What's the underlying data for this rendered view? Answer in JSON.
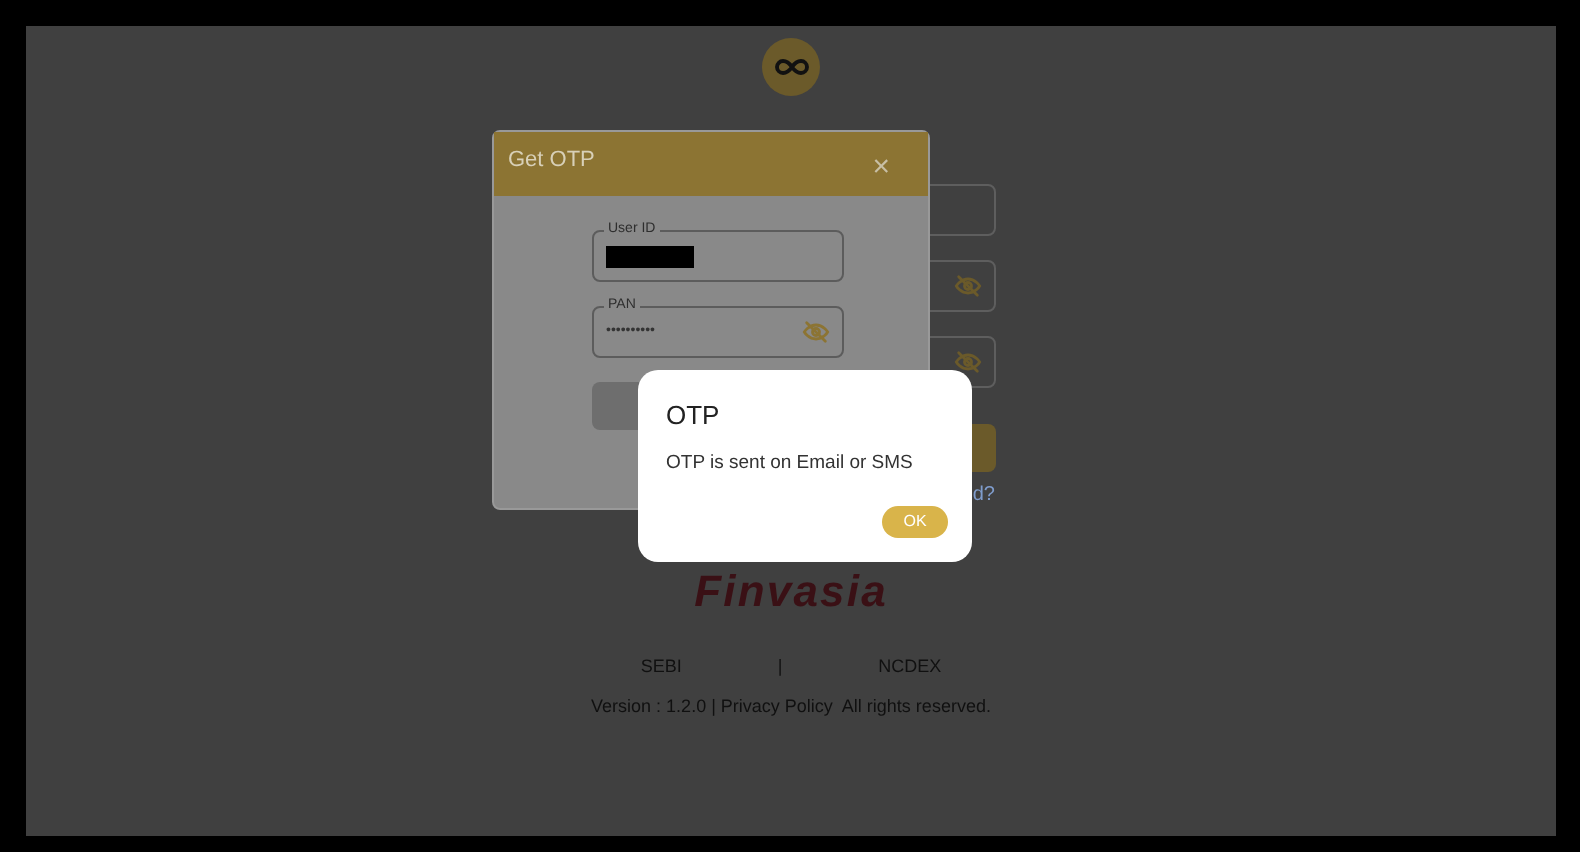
{
  "login_form": {
    "fields": [
      {
        "masked": false
      },
      {
        "masked": true
      },
      {
        "masked": true
      }
    ],
    "link": "d?"
  },
  "brand": "Finvasia",
  "footer": {
    "links": [
      "SEBI",
      "|",
      "NCDEX"
    ],
    "version_line": "Version : 1.2.0 | Privacy Policy  All rights reserved."
  },
  "get_otp_modal": {
    "title": "Get OTP",
    "close": "×",
    "fields": [
      {
        "label": "User ID",
        "redacted": true,
        "masked": false
      },
      {
        "label": "PAN",
        "redacted": false,
        "value": "••••••••••",
        "masked": true
      }
    ]
  },
  "otp_dialog": {
    "title": "OTP",
    "message": "OTP is sent on Email or SMS",
    "button": "OK"
  }
}
